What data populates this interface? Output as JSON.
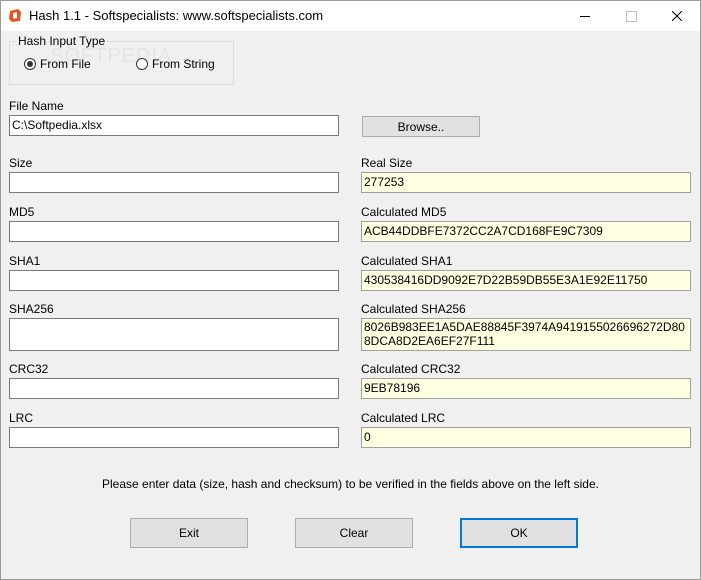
{
  "window": {
    "title": "Hash 1.1 - Softspecialists: www.softspecialists.com",
    "controls": [
      "minimize-icon",
      "maximize-icon",
      "close-icon"
    ]
  },
  "input_type": {
    "label": "Hash Input Type",
    "options": [
      {
        "label": "From File",
        "selected": true
      },
      {
        "label": "From String",
        "selected": false
      }
    ],
    "watermark": "SOFTPEDIA"
  },
  "file": {
    "label": "File Name",
    "value": "C:\\Softpedia.xlsx",
    "browse_label": "Browse.."
  },
  "left_fields": [
    {
      "label": "Size",
      "value": ""
    },
    {
      "label": "MD5",
      "value": ""
    },
    {
      "label": "SHA1",
      "value": ""
    },
    {
      "label": "SHA256",
      "value": ""
    },
    {
      "label": "CRC32",
      "value": ""
    },
    {
      "label": "LRC",
      "value": ""
    }
  ],
  "right_fields": [
    {
      "label": "Real Size",
      "value": "277253"
    },
    {
      "label": "Calculated MD5",
      "value": "ACB44DDBFE7372CC2A7CD168FE9C7309"
    },
    {
      "label": "Calculated SHA1",
      "value": "430538416DD9092E7D22B59DB55E3A1E92E11750"
    },
    {
      "label": "Calculated SHA256",
      "value": "8026B983EE1A5DAE88845F3974A9419155026696272D808DCA8D2EA6EF27F111"
    },
    {
      "label": "Calculated CRC32",
      "value": "9EB78196"
    },
    {
      "label": "Calculated LRC",
      "value": "0"
    }
  ],
  "hint": "Please enter data (size, hash and checksum) to be verified in the fields above on the left side.",
  "buttons": {
    "exit": "Exit",
    "clear": "Clear",
    "ok": "OK"
  },
  "colors": {
    "calc_background": "#ffffe1",
    "default_button_border": "#0078d7",
    "icon_orange": "#e8541e"
  }
}
